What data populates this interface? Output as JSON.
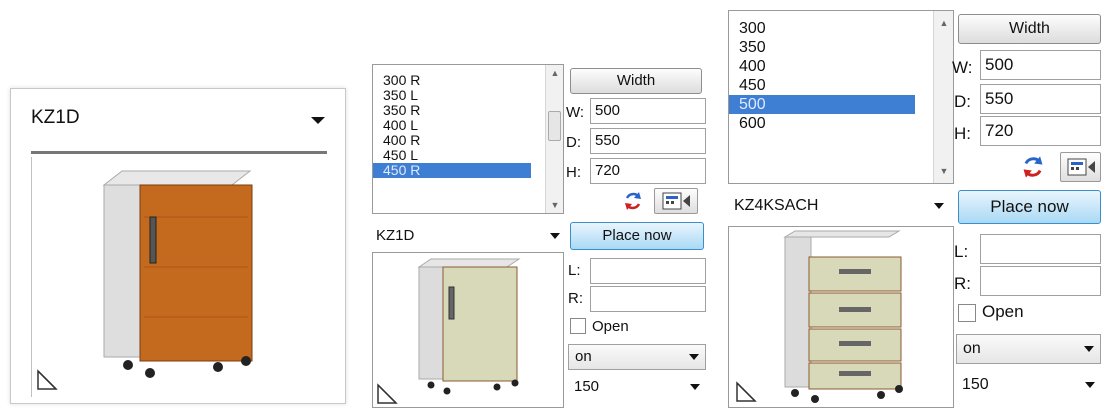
{
  "panel1": {
    "combo_value": "KZ1D"
  },
  "panel2": {
    "list_items": [
      "300  R",
      "350 L",
      "350  R",
      "400 L",
      "400  R",
      "450 L",
      "450  R"
    ],
    "selected_index": 6,
    "width_label": "Width",
    "w_label": "W:",
    "w_value": "500",
    "d_label": "D:",
    "d_value": "550",
    "h_label": "H:",
    "h_value": "720",
    "combo_value": "KZ1D",
    "place_label": "Place now",
    "l_label": "L:",
    "r_label": "R:",
    "open_label": "Open",
    "on_value": "on",
    "size_value": "150"
  },
  "panel3": {
    "list_items": [
      "300",
      "350",
      "400",
      "450",
      "500",
      "600"
    ],
    "selected_index": 4,
    "width_label": "Width",
    "w_label": "W:",
    "w_value": "500",
    "d_label": "D:",
    "d_value": "550",
    "h_label": "H:",
    "h_value": "720",
    "combo_value": "KZ4KSACH",
    "place_label": "Place now",
    "l_label": "L:",
    "r_label": "R:",
    "open_label": "Open",
    "on_value": "on",
    "size_value": "150"
  },
  "icons": [
    "refresh-icon",
    "calculator-icon",
    "dropdown-arrow-icon",
    "perspective-corner-icon"
  ],
  "colors": {
    "selection": "#3f7fd3",
    "place_button": "#a9d9f5",
    "wood_door": "#c46a1e",
    "green_door": "#d8d9b8"
  }
}
